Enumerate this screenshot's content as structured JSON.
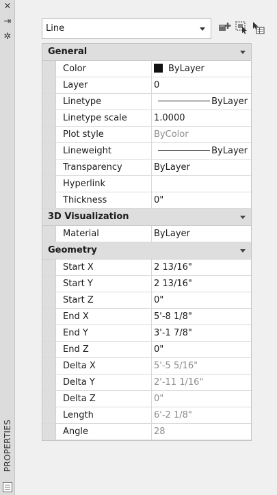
{
  "strip": {
    "title": "PROPERTIES",
    "icons": [
      "close-icon",
      "auto-hide-icon",
      "settings-icon",
      "properties-panel-icon"
    ]
  },
  "selector": {
    "value": "Line",
    "tool_icons": [
      "toggle-pickadd-icon",
      "select-objects-icon",
      "quick-select-icon"
    ]
  },
  "sections": {
    "general": {
      "title": "General",
      "rows": [
        {
          "name": "Color",
          "value": "ByLayer"
        },
        {
          "name": "Layer",
          "value": "0"
        },
        {
          "name": "Linetype",
          "value": "ByLayer"
        },
        {
          "name": "Linetype scale",
          "value": "1.0000"
        },
        {
          "name": "Plot style",
          "value": "ByColor"
        },
        {
          "name": "Lineweight",
          "value": "ByLayer"
        },
        {
          "name": "Transparency",
          "value": "ByLayer"
        },
        {
          "name": "Hyperlink",
          "value": ""
        },
        {
          "name": "Thickness",
          "value": "0\""
        }
      ]
    },
    "viz3d": {
      "title": "3D Visualization",
      "rows": [
        {
          "name": "Material",
          "value": "ByLayer"
        }
      ]
    },
    "geometry": {
      "title": "Geometry",
      "rows": [
        {
          "name": "Start X",
          "value": "2 13/16\""
        },
        {
          "name": "Start Y",
          "value": "2 13/16\""
        },
        {
          "name": "Start Z",
          "value": "0\""
        },
        {
          "name": "End X",
          "value": "5'-8 1/8\""
        },
        {
          "name": "End Y",
          "value": "3'-1 7/8\""
        },
        {
          "name": "End Z",
          "value": "0\""
        },
        {
          "name": "Delta X",
          "value": "5'-5 5/16\""
        },
        {
          "name": "Delta Y",
          "value": "2'-11 1/16\""
        },
        {
          "name": "Delta Z",
          "value": "0\""
        },
        {
          "name": "Length",
          "value": "6'-2 1/8\""
        },
        {
          "name": "Angle",
          "value": "28"
        }
      ]
    }
  },
  "colors": {
    "color_swatch": "#111111",
    "muted_value": "#8c8c8c"
  }
}
